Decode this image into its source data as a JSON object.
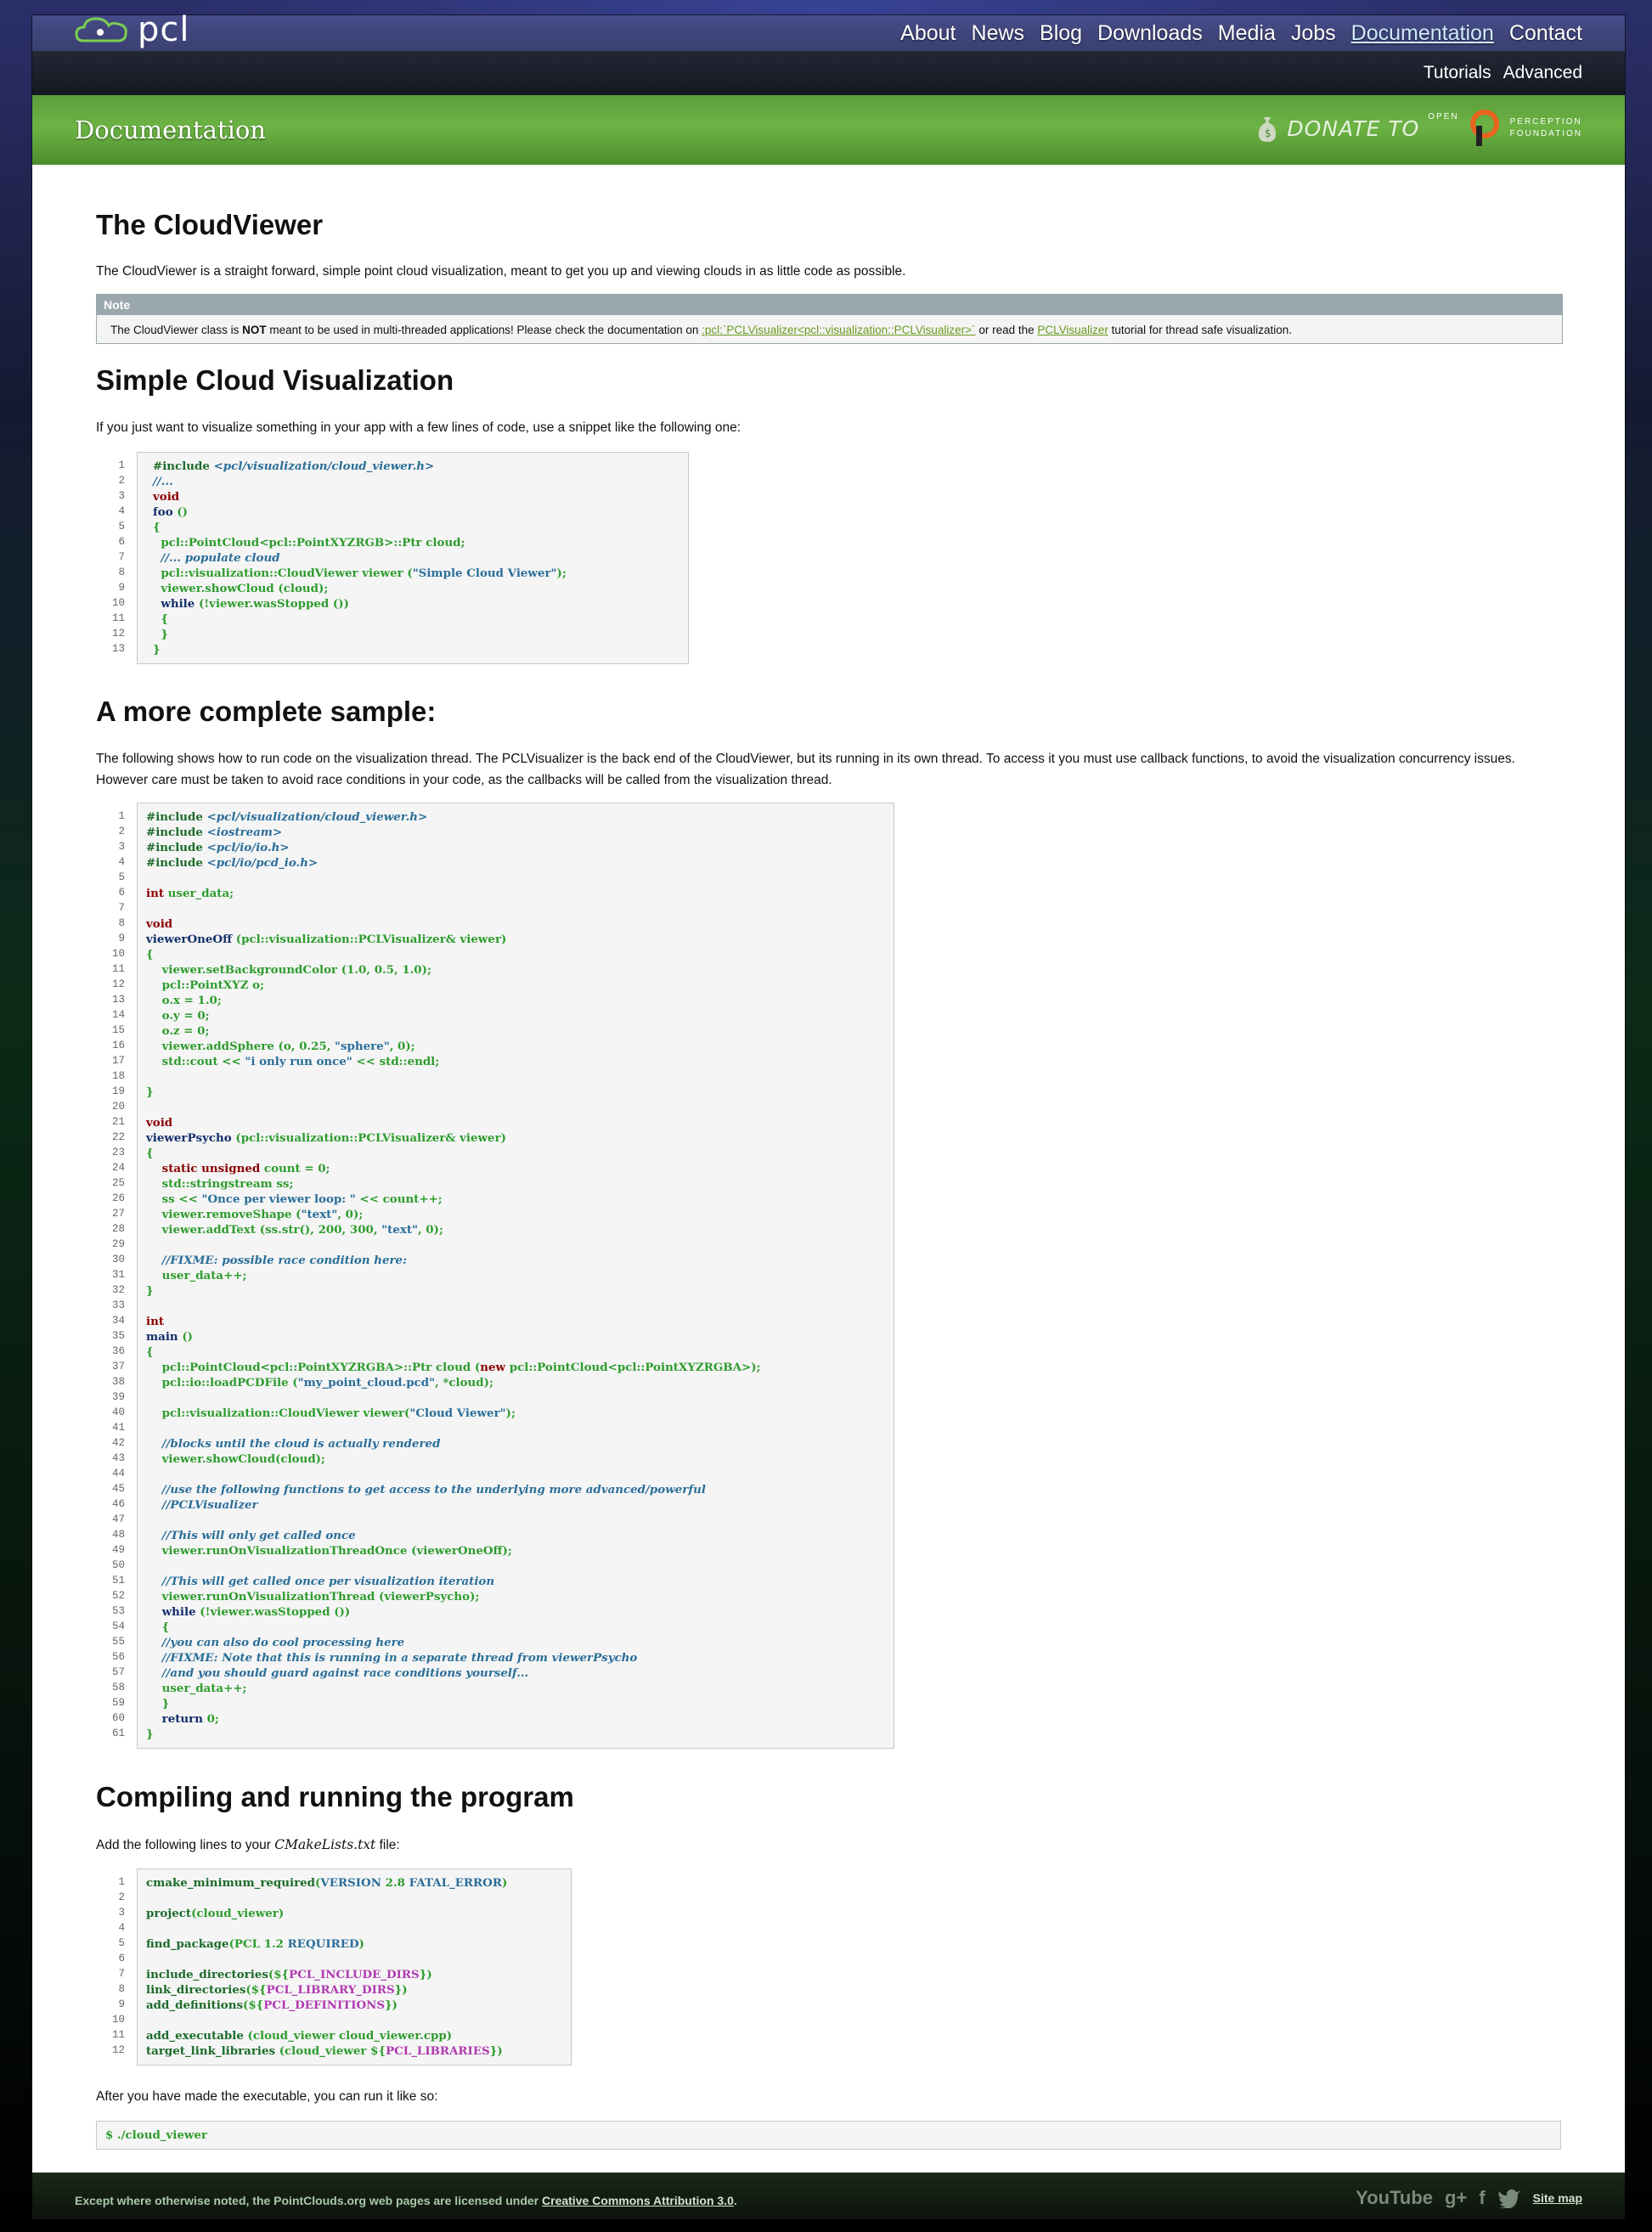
{
  "brand": {
    "logo_text": "pcl"
  },
  "top_nav": [
    "About",
    "News",
    "Blog",
    "Downloads",
    "Media",
    "Jobs",
    "Documentation",
    "Contact"
  ],
  "top_nav_active": "Documentation",
  "sub_nav": [
    "Tutorials",
    "Advanced"
  ],
  "banner": {
    "title": "Documentation",
    "donate_text": "DONATE TO",
    "org_open": "OPEN",
    "org_perception": "PERCEPTION",
    "org_foundation": "FOUNDATION"
  },
  "sections": {
    "cloudviewer": {
      "heading": "The CloudViewer",
      "intro": "The CloudViewer is a straight forward, simple point cloud visualization, meant to get you up and viewing clouds in as little code as possible.",
      "note_title": "Note",
      "note_pre": "The CloudViewer class is ",
      "note_bold": "NOT",
      "note_mid": " meant to be used in multi-threaded applications! Please check the documentation on ",
      "note_link1": ":pcl:`PCLVisualizer<pcl::visualization::PCLVisualizer>`",
      "note_mid2": " or read the ",
      "note_link2": "PCLVisualizer",
      "note_post": " tutorial for thread safe visualization."
    },
    "simple": {
      "heading": "Simple Cloud Visualization",
      "intro": "If you just want to visualize something in your app with a few lines of code, use a snippet like the following one:"
    },
    "complete": {
      "heading": "A more complete sample:",
      "intro": "The following shows how to run code on the visualization thread. The PCLVisualizer is the back end of the CloudViewer, but its running in its own thread. To access it you must use callback functions, to avoid the visualization concurrency issues. However care must be taken to avoid race conditions in your code, as the callbacks will be called from the visualization thread."
    },
    "compile": {
      "heading": "Compiling and running the program",
      "intro_pre": "Add the following lines to your ",
      "intro_file": "CMakeLists.txt",
      "intro_post": " file:",
      "run_intro": "After you have made the executable, you can run it like so:",
      "run_cmd": "$ ./cloud_viewer"
    }
  },
  "code_simple": [
    "#include <pcl/visualization/cloud_viewer.h>",
    "//...",
    "void",
    "foo ()",
    "{",
    "  pcl::PointCloud<pcl::PointXYZRGB>::Ptr cloud;",
    "  //... populate cloud",
    "  pcl::visualization::CloudViewer viewer (\"Simple Cloud Viewer\");",
    "  viewer.showCloud (cloud);",
    "  while (!viewer.wasStopped ())",
    "  {",
    "  }",
    "}"
  ],
  "code_complete": [
    "#include <pcl/visualization/cloud_viewer.h>",
    "#include <iostream>",
    "#include <pcl/io/io.h>",
    "#include <pcl/io/pcd_io.h>",
    "",
    "int user_data;",
    "",
    "void",
    "viewerOneOff (pcl::visualization::PCLVisualizer& viewer)",
    "{",
    "    viewer.setBackgroundColor (1.0, 0.5, 1.0);",
    "    pcl::PointXYZ o;",
    "    o.x = 1.0;",
    "    o.y = 0;",
    "    o.z = 0;",
    "    viewer.addSphere (o, 0.25, \"sphere\", 0);",
    "    std::cout << \"i only run once\" << std::endl;",
    "",
    "}",
    "",
    "void",
    "viewerPsycho (pcl::visualization::PCLVisualizer& viewer)",
    "{",
    "    static unsigned count = 0;",
    "    std::stringstream ss;",
    "    ss << \"Once per viewer loop: \" << count++;",
    "    viewer.removeShape (\"text\", 0);",
    "    viewer.addText (ss.str(), 200, 300, \"text\", 0);",
    "",
    "    //FIXME: possible race condition here:",
    "    user_data++;",
    "}",
    "",
    "int",
    "main ()",
    "{",
    "    pcl::PointCloud<pcl::PointXYZRGBA>::Ptr cloud (new pcl::PointCloud<pcl::PointXYZRGBA>);",
    "    pcl::io::loadPCDFile (\"my_point_cloud.pcd\", *cloud);",
    "",
    "    pcl::visualization::CloudViewer viewer(\"Cloud Viewer\");",
    "",
    "    //blocks until the cloud is actually rendered",
    "    viewer.showCloud(cloud);",
    "",
    "    //use the following functions to get access to the underlying more advanced/powerful",
    "    //PCLVisualizer",
    "",
    "    //This will only get called once",
    "    viewer.runOnVisualizationThreadOnce (viewerOneOff);",
    "",
    "    //This will get called once per visualization iteration",
    "    viewer.runOnVisualizationThread (viewerPsycho);",
    "    while (!viewer.wasStopped ())",
    "    {",
    "    //you can also do cool processing here",
    "    //FIXME: Note that this is running in a separate thread from viewerPsycho",
    "    //and you should guard against race conditions yourself...",
    "    user_data++;",
    "    }",
    "    return 0;",
    "}"
  ],
  "code_cmake": [
    "cmake_minimum_required(VERSION 2.8 FATAL_ERROR)",
    "",
    "project(cloud_viewer)",
    "",
    "find_package(PCL 1.2 REQUIRED)",
    "",
    "include_directories(${PCL_INCLUDE_DIRS})",
    "link_directories(${PCL_LIBRARY_DIRS})",
    "add_definitions(${PCL_DEFINITIONS})",
    "",
    "add_executable (cloud_viewer cloud_viewer.cpp)",
    "target_link_libraries (cloud_viewer ${PCL_LIBRARIES})"
  ],
  "footer": {
    "text_pre": "Except where otherwise noted, the PointClouds.org web pages are licensed under ",
    "license_link": "Creative Commons Attribution 3.0",
    "text_post": ".",
    "social_youtube": "YouTube",
    "social_gplus": "g+",
    "social_facebook": "f",
    "sitemap": "Site map"
  }
}
